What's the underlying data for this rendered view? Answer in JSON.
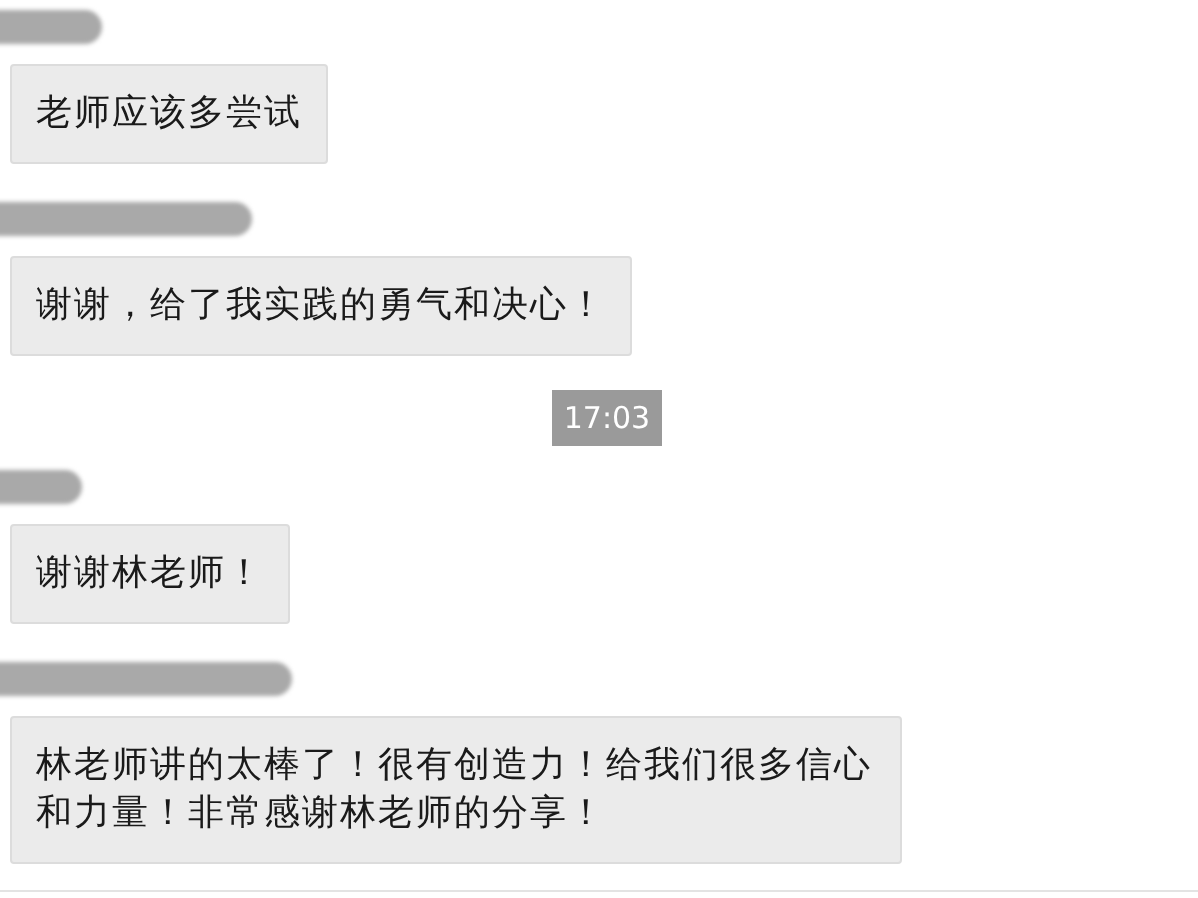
{
  "messages": [
    {
      "kind": "message",
      "text": "老师应该多尝试"
    },
    {
      "kind": "message",
      "text": "谢谢，给了我实践的勇气和决心！"
    },
    {
      "kind": "time",
      "text": "17:03"
    },
    {
      "kind": "message",
      "text": "谢谢林老师！"
    },
    {
      "kind": "message",
      "text": "林老师讲的太棒了！很有创造力！给我们很多信心和力量！非常感谢林老师的分享！"
    }
  ]
}
